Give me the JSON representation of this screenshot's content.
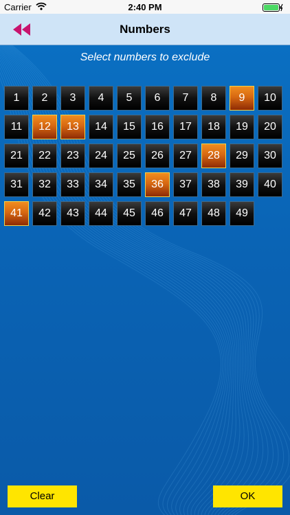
{
  "status_bar": {
    "carrier": "Carrier",
    "time": "2:40 PM",
    "wifi_icon": "wifi-icon",
    "battery_icon": "battery-charging-icon"
  },
  "nav": {
    "title": "Numbers",
    "back_icon": "rewind-icon",
    "back_color": "#c8146e"
  },
  "subtitle": "Select numbers to exclude",
  "numbers": [
    "1",
    "2",
    "3",
    "4",
    "5",
    "6",
    "7",
    "8",
    "9",
    "10",
    "11",
    "12",
    "13",
    "14",
    "15",
    "16",
    "17",
    "18",
    "19",
    "20",
    "21",
    "22",
    "23",
    "24",
    "25",
    "26",
    "27",
    "28",
    "29",
    "30",
    "31",
    "32",
    "33",
    "34",
    "35",
    "36",
    "37",
    "38",
    "39",
    "40",
    "41",
    "42",
    "43",
    "44",
    "45",
    "46",
    "47",
    "48",
    "49"
  ],
  "selected": [
    "9",
    "12",
    "13",
    "28",
    "36",
    "41"
  ],
  "footer": {
    "clear_label": "Clear",
    "ok_label": "OK"
  },
  "colors": {
    "background": "#0a63b4",
    "selected": "#d76812",
    "button_accent": "#ffe500"
  }
}
